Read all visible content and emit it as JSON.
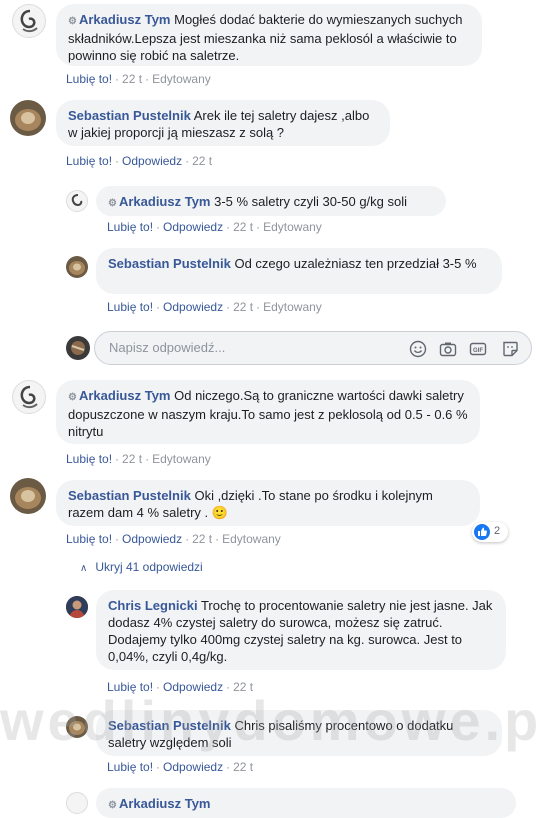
{
  "comments": [
    {
      "author": "Arkadiusz Tym",
      "text": "Mogłeś dodać bakterie do wymieszanych suchych składników.Lepsza jest mieszanka niż sama peklosól a właściwie to powinno się robić na saletrze.",
      "like": "Lubię to!",
      "time": "22 t",
      "edited": "Edytowany"
    },
    {
      "author": "Sebastian Pustelnik",
      "text": "Arek ile tej saletry dajesz ,albo w jakiej proporcji ją mieszasz z solą ?",
      "like": "Lubię to!",
      "reply": "Odpowiedz",
      "time": "22 t"
    },
    {
      "author": "Arkadiusz Tym",
      "text": "3-5 % saletry czyli 30-50 g/kg soli",
      "like": "Lubię to!",
      "reply": "Odpowiedz",
      "time": "22 t",
      "edited": "Edytowany"
    },
    {
      "author": "Sebastian Pustelnik",
      "text": "Od czego uzależniasz ten przedział 3-5 %",
      "like": "Lubię to!",
      "reply": "Odpowiedz",
      "time": "22 t",
      "edited": "Edytowany"
    },
    {
      "author": "Arkadiusz Tym",
      "text": "Od niczego.Są to graniczne wartości dawki saletry dopuszczone w naszym kraju.To samo jest z peklosolą od 0.5 - 0.6 % nitrytu",
      "like": "Lubię to!",
      "time": "22 t",
      "edited": "Edytowany"
    },
    {
      "author": "Sebastian Pustelnik",
      "text": "Oki ,dzięki .To stane po środku i kolejnym razem dam 4 % saletry .",
      "emoji": "🙂",
      "like": "Lubię to!",
      "reply": "Odpowiedz",
      "time": "22 t",
      "edited": "Edytowany",
      "reactions_count": "2"
    },
    {
      "author": "Chris Legnicki",
      "text": "Trochę to procentowanie saletry nie jest jasne. Jak dodasz 4% czystej saletry do surowca, możesz się zatruć. Dodajemy tylko 400mg czystej saletry na kg. surowca. Jest to 0,04%, czyli 0,4g/kg.",
      "like": "Lubię to!",
      "reply": "Odpowiedz",
      "time": "22 t"
    },
    {
      "author": "Sebastian Pustelnik",
      "text": "Chris pisaliśmy procentowo o dodatku saletry względem soli",
      "like": "Lubię to!",
      "reply": "Odpowiedz",
      "time": "22 t"
    }
  ],
  "reply_box": {
    "placeholder": "Napisz odpowiedź..."
  },
  "hide_replies": "Ukryj 41 odpowiedzi",
  "watermark": "wedlinydomowe.p",
  "bottom_partial": {
    "author": "Arkadiusz Tym"
  },
  "colors": {
    "link": "#385898",
    "bubble": "#f2f3f5",
    "muted": "#90949c",
    "like_blue": "#1877f2"
  }
}
